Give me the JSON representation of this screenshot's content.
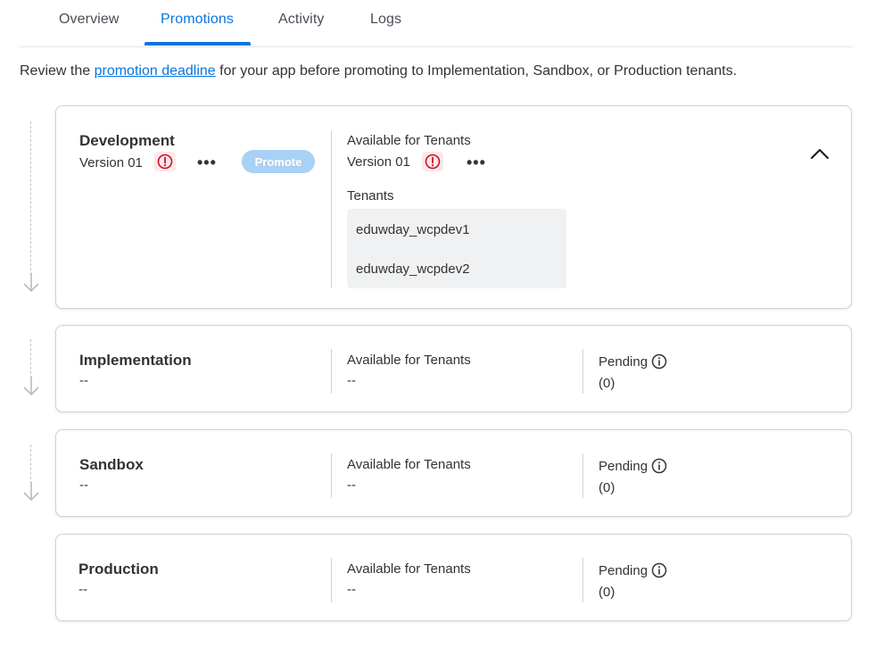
{
  "tabs": [
    {
      "label": "Overview",
      "active": false
    },
    {
      "label": "Promotions",
      "active": true
    },
    {
      "label": "Activity",
      "active": false
    },
    {
      "label": "Logs",
      "active": false
    }
  ],
  "intro": {
    "prefix": "Review the ",
    "link": "promotion deadline",
    "suffix": " for your app before promoting to Implementation, Sandbox, or Production tenants."
  },
  "colors": {
    "accent": "#0875e1",
    "warning": "#c8102e",
    "promote_disabled": "#a9d0f5"
  },
  "stages": {
    "development": {
      "title": "Development",
      "version": "Version 01",
      "promote_label": "Promote",
      "available_label": "Available for Tenants",
      "available_version": "Version 01",
      "tenants_label": "Tenants",
      "tenants": [
        "eduwday_wcpdev1",
        "eduwday_wcpdev2"
      ]
    },
    "implementation": {
      "title": "Implementation",
      "version": "--",
      "available_label": "Available for Tenants",
      "available_value": "--",
      "pending_label": "Pending",
      "pending_count": "(0)"
    },
    "sandbox": {
      "title": "Sandbox",
      "version": "--",
      "available_label": "Available for Tenants",
      "available_value": "--",
      "pending_label": "Pending",
      "pending_count": "(0)"
    },
    "production": {
      "title": "Production",
      "version": "--",
      "available_label": "Available for Tenants",
      "available_value": "--",
      "pending_label": "Pending",
      "pending_count": "(0)"
    }
  },
  "icons": {
    "warning": "exclamation-circle-icon",
    "more": "more-horizontal-icon",
    "info": "info-circle-icon",
    "collapse": "chevron-up-icon",
    "flow": "arrow-down-icon"
  }
}
